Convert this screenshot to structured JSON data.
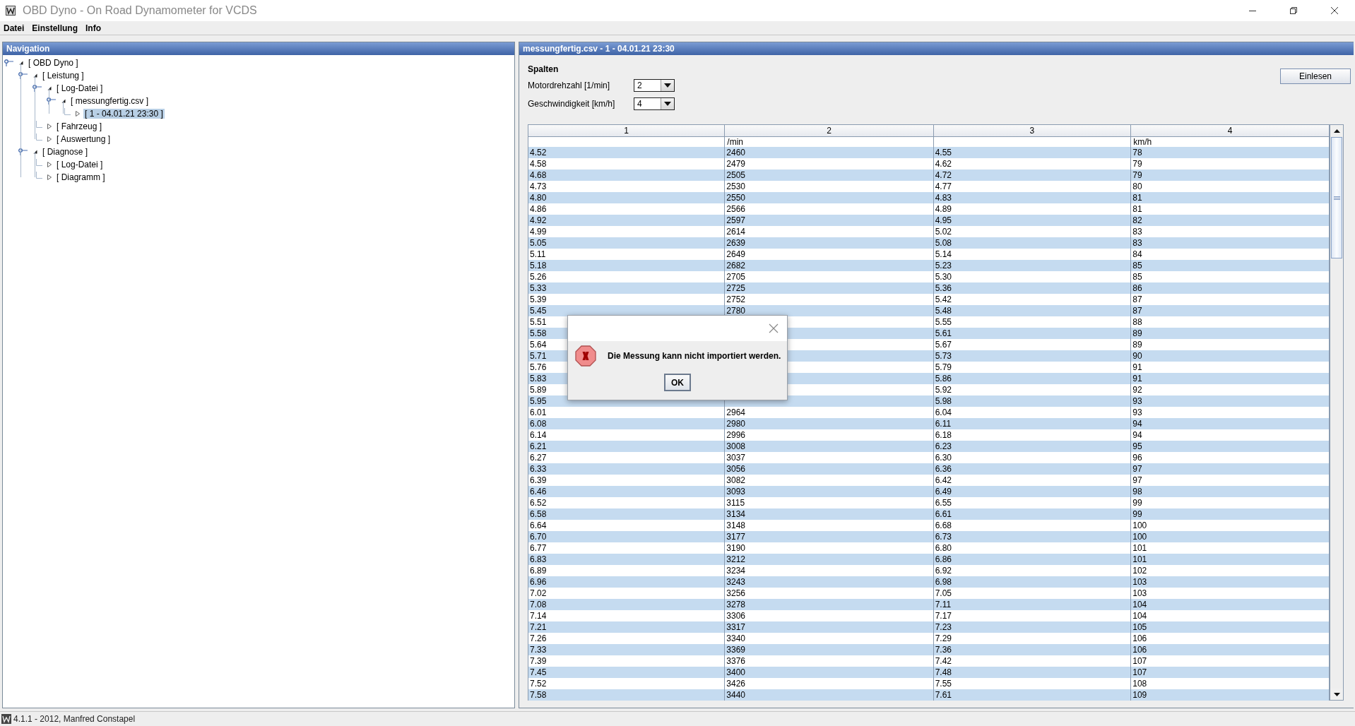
{
  "window": {
    "title": "OBD Dyno - On Road Dynamometer for VCDS"
  },
  "menu": [
    "Datei",
    "Einstellung",
    "Info"
  ],
  "navigation": {
    "title": "Navigation",
    "tree": [
      {
        "label": "[ OBD Dyno ]",
        "expanded": true,
        "selected": false,
        "children": [
          {
            "label": "[ Leistung ]",
            "expanded": true,
            "selected": false,
            "children": [
              {
                "label": "[ Log-Datei ]",
                "expanded": true,
                "selected": false,
                "children": [
                  {
                    "label": "[ messungfertig.csv ]",
                    "expanded": true,
                    "selected": false,
                    "children": [
                      {
                        "label": "[ 1 - 04.01.21 23:30 ]",
                        "expanded": false,
                        "selected": true
                      }
                    ]
                  }
                ]
              },
              {
                "label": "[ Fahrzeug ]",
                "expanded": false,
                "selected": false
              },
              {
                "label": "[ Auswertung ]",
                "expanded": false,
                "selected": false
              }
            ]
          },
          {
            "label": "[ Diagnose ]",
            "expanded": true,
            "selected": false,
            "children": [
              {
                "label": "[ Log-Datei ]",
                "expanded": false,
                "selected": false
              },
              {
                "label": "[ Diagramm ]",
                "expanded": false,
                "selected": false
              }
            ]
          }
        ]
      }
    ]
  },
  "content": {
    "title": "messungfertig.csv - 1 - 04.01.21 23:30",
    "section_label": "Spalten",
    "fields": [
      {
        "label": "Motordrehzahl  [1/min]",
        "value": "2"
      },
      {
        "label": "Geschwindigkeit  [km/h]",
        "value": "4"
      }
    ],
    "read_button": "Einlesen",
    "table": {
      "columns": [
        {
          "label": "1"
        },
        {
          "label": "2",
          "unit": "/min"
        },
        {
          "label": "3"
        },
        {
          "label": "4",
          "unit": "km/h"
        }
      ],
      "rows": [
        [
          "4.52",
          "2460",
          "4.55",
          "78"
        ],
        [
          "4.58",
          "2479",
          "4.62",
          "79"
        ],
        [
          "4.68",
          "2505",
          "4.72",
          "79"
        ],
        [
          "4.73",
          "2530",
          "4.77",
          "80"
        ],
        [
          "4.80",
          "2550",
          "4.83",
          "81"
        ],
        [
          "4.86",
          "2566",
          "4.89",
          "81"
        ],
        [
          "4.92",
          "2597",
          "4.95",
          "82"
        ],
        [
          "4.99",
          "2614",
          "5.02",
          "83"
        ],
        [
          "5.05",
          "2639",
          "5.08",
          "83"
        ],
        [
          "5.11",
          "2649",
          "5.14",
          "84"
        ],
        [
          "5.18",
          "2682",
          "5.23",
          "85"
        ],
        [
          "5.26",
          "2705",
          "5.30",
          "85"
        ],
        [
          "5.33",
          "2725",
          "5.36",
          "86"
        ],
        [
          "5.39",
          "2752",
          "5.42",
          "87"
        ],
        [
          "5.45",
          "2780",
          "5.48",
          "87"
        ],
        [
          "5.51",
          null,
          "5.55",
          "88"
        ],
        [
          "5.58",
          null,
          "5.61",
          "89"
        ],
        [
          "5.64",
          null,
          "5.67",
          "89"
        ],
        [
          "5.71",
          null,
          "5.73",
          "90"
        ],
        [
          "5.76",
          null,
          "5.79",
          "91"
        ],
        [
          "5.83",
          null,
          "5.86",
          "91"
        ],
        [
          "5.89",
          null,
          "5.92",
          "92"
        ],
        [
          "5.95",
          null,
          "5.98",
          "93"
        ],
        [
          "6.01",
          "2964",
          "6.04",
          "93"
        ],
        [
          "6.08",
          "2980",
          "6.11",
          "94"
        ],
        [
          "6.14",
          "2996",
          "6.18",
          "94"
        ],
        [
          "6.21",
          "3008",
          "6.23",
          "95"
        ],
        [
          "6.27",
          "3037",
          "6.30",
          "96"
        ],
        [
          "6.33",
          "3056",
          "6.36",
          "97"
        ],
        [
          "6.39",
          "3082",
          "6.42",
          "97"
        ],
        [
          "6.46",
          "3093",
          "6.49",
          "98"
        ],
        [
          "6.52",
          "3115",
          "6.55",
          "99"
        ],
        [
          "6.58",
          "3134",
          "6.61",
          "99"
        ],
        [
          "6.64",
          "3148",
          "6.68",
          "100"
        ],
        [
          "6.70",
          "3177",
          "6.73",
          "100"
        ],
        [
          "6.77",
          "3190",
          "6.80",
          "101"
        ],
        [
          "6.83",
          "3212",
          "6.86",
          "101"
        ],
        [
          "6.89",
          "3234",
          "6.92",
          "102"
        ],
        [
          "6.96",
          "3243",
          "6.98",
          "103"
        ],
        [
          "7.02",
          "3256",
          "7.05",
          "103"
        ],
        [
          "7.08",
          "3278",
          "7.11",
          "104"
        ],
        [
          "7.14",
          "3306",
          "7.17",
          "104"
        ],
        [
          "7.21",
          "3317",
          "7.23",
          "105"
        ],
        [
          "7.26",
          "3340",
          "7.29",
          "106"
        ],
        [
          "7.33",
          "3369",
          "7.36",
          "106"
        ],
        [
          "7.39",
          "3376",
          "7.42",
          "107"
        ],
        [
          "7.45",
          "3400",
          "7.48",
          "107"
        ],
        [
          "7.52",
          "3426",
          "7.55",
          "108"
        ],
        [
          "7.58",
          "3440",
          "7.61",
          "109"
        ]
      ]
    }
  },
  "dialog": {
    "message": "Die Messung kann nicht importiert werden.",
    "ok_button": "OK"
  },
  "status_bar": {
    "text": "4.1.1 - 2012, Manfred Constapel"
  }
}
